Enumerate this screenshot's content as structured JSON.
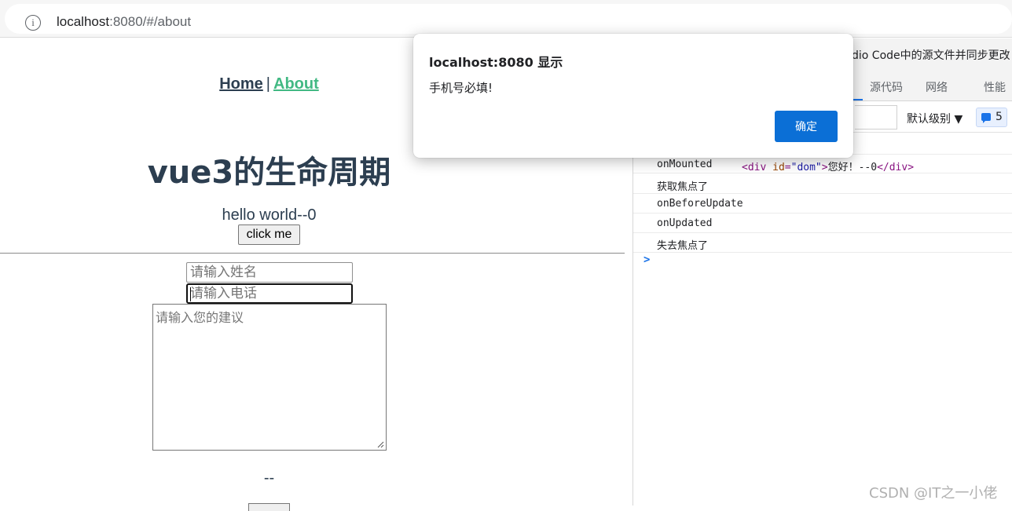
{
  "address_bar": {
    "url_host": "localhost",
    "url_rest": ":8080/#/about"
  },
  "page": {
    "nav": {
      "home": "Home",
      "separator": "|",
      "about": "About"
    },
    "title": "vue3的生命周期",
    "hello": "hello world--0",
    "click_button": "click me",
    "name_placeholder": "请输入姓名",
    "phone_placeholder": "请输入电话",
    "suggestion_placeholder": "请输入您的建议",
    "dashes": "--"
  },
  "devtools": {
    "info_bar_text": "dio Code中的源文件并同步更改",
    "tabs": [
      "源代码",
      "网络",
      "性能"
    ],
    "level_select": "默认级别",
    "issues_count": "5",
    "console_rows": [
      {
        "text": "onMounted",
        "element": {
          "tag_open": "<div ",
          "attr": "id",
          "eq": "=",
          "value": "\"dom\"",
          "close": ">",
          "content": "您好！--0",
          "tag_close": "</div>"
        }
      },
      {
        "text": "获取焦点了"
      },
      {
        "text": "onBeforeUpdate"
      },
      {
        "text": "onUpdated"
      },
      {
        "text": "失去焦点了"
      }
    ],
    "prompt": ">"
  },
  "dialog": {
    "title": "localhost:8080 显示",
    "message": "手机号必填!",
    "ok_label": "确定"
  },
  "watermark": "CSDN @IT之一小佬",
  "colors": {
    "link": "#2c3e50",
    "link_active": "#42b983",
    "dialog_button": "#0b6fd6"
  }
}
